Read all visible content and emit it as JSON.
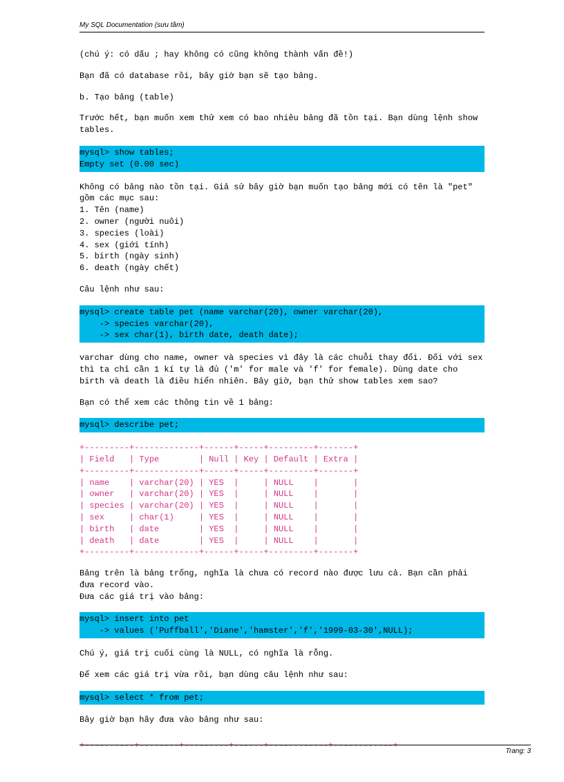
{
  "header": "My SQL Documentation (sưu tầm)",
  "p1": "(chú ý: có dấu ; hay không có cũng không thành vấn đề!)",
  "p2": "Bạn đã có database rồi, bây giờ bạn sẽ tạo bảng.",
  "p3": "b. Tạo bảng (table)",
  "p4": "Trước hết, bạn muốn xem thử xem có bao nhiêu bảng đã tồn tại. Bạn dùng lệnh show tables.",
  "code1": "mysql> show tables;\nEmpty set (0.00 sec)",
  "p5": "Không có bảng nào tồn tại. Giả sử bây giờ bạn muốn tạo bảng mới có tên là \"pet\" gồm các mục sau:",
  "list1": "1. Tên (name)\n2. owner (người nuôi)\n3. species (loài)\n4. sex (giới tính)\n5. birth (ngày sinh)\n6. death (ngày chết)",
  "p6": "Câu lệnh như sau:",
  "code2": "mysql> create table pet (name varchar(20), owner varchar(20),\n    -> species varchar(20),\n    -> sex char(1), birth date, death date);",
  "p7": "varchar dùng cho name, owner và species vì đây là các chuỗi thay đổi. Đối với sex thì ta chỉ cần 1 kí tự là đủ ('m' for male và 'f' for female). Dùng date cho birth và death là điều hiển nhiên. Bây giờ, bạn thử show tables xem sao?",
  "p8": "Bạn có thể xem các thông tin về 1 bảng:",
  "code3": "mysql> describe pet;",
  "table1": "+---------+-------------+------+-----+---------+-------+\n| Field   | Type        | Null | Key | Default | Extra |\n+---------+-------------+------+-----+---------+-------+\n| name    | varchar(20) | YES  |     | NULL    |       |\n| owner   | varchar(20) | YES  |     | NULL    |       |\n| species | varchar(20) | YES  |     | NULL    |       |\n| sex     | char(1)     | YES  |     | NULL    |       |\n| birth   | date        | YES  |     | NULL    |       |\n| death   | date        | YES  |     | NULL    |       |\n+---------+-------------+------+-----+---------+-------+",
  "p9": "Bảng trên là bảng trống, nghĩa là chưa có record nào được lưu cả. Bạn cần phải đưa record vào.\nĐưa các giá trị vào bảng:",
  "code4": "mysql> insert into pet\n    -> values ('Puffball','Diane','hamster','f','1999-03-30',NULL);",
  "p10": "Chú ý, giá trị cuối cùng là NULL, có nghĩa là rỗng.",
  "p11": "Để xem các giá trị vừa rồi, bạn dùng câu lệnh như sau:",
  "code5": "mysql> select * from pet;",
  "p12": "Bây giờ bạn hãy đưa vào bảng như sau:",
  "table2": "+----------+--------+---------+------+------------+------------+",
  "footer": "Trang: 3"
}
